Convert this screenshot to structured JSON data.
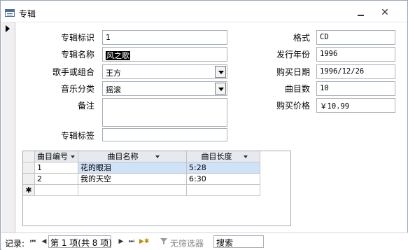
{
  "window": {
    "title": "专辑"
  },
  "form": {
    "left_fields": [
      {
        "label": "专辑标识",
        "value": "1"
      },
      {
        "label": "专辑名称",
        "value": "风之歌"
      },
      {
        "label": "歌手或组合",
        "value": "王方"
      },
      {
        "label": "音乐分类",
        "value": "摇滚"
      },
      {
        "label": "备注",
        "value": ""
      },
      {
        "label": "专辑标签",
        "value": ""
      }
    ],
    "right_fields": [
      {
        "label": "格式",
        "value": "CD"
      },
      {
        "label": "发行年份",
        "value": "1996"
      },
      {
        "label": "购买日期",
        "value": "1996/12/26"
      },
      {
        "label": "曲目数",
        "value": "10"
      },
      {
        "label": "购买价格",
        "value": "￥10.99"
      }
    ]
  },
  "subform": {
    "columns": [
      "曲目编号",
      "曲目名称",
      "曲目长度"
    ],
    "rows": [
      {
        "id": "1",
        "name": "花的眼泪",
        "length": "5:28"
      },
      {
        "id": "2",
        "name": "我的天空",
        "length": "6:30"
      }
    ],
    "new_row_marker": "✱"
  },
  "navbar": {
    "label": "记录:",
    "position_text": "第 1 项(共 8 项)",
    "filter_label": "无筛选器",
    "search_placeholder": "搜索"
  }
}
